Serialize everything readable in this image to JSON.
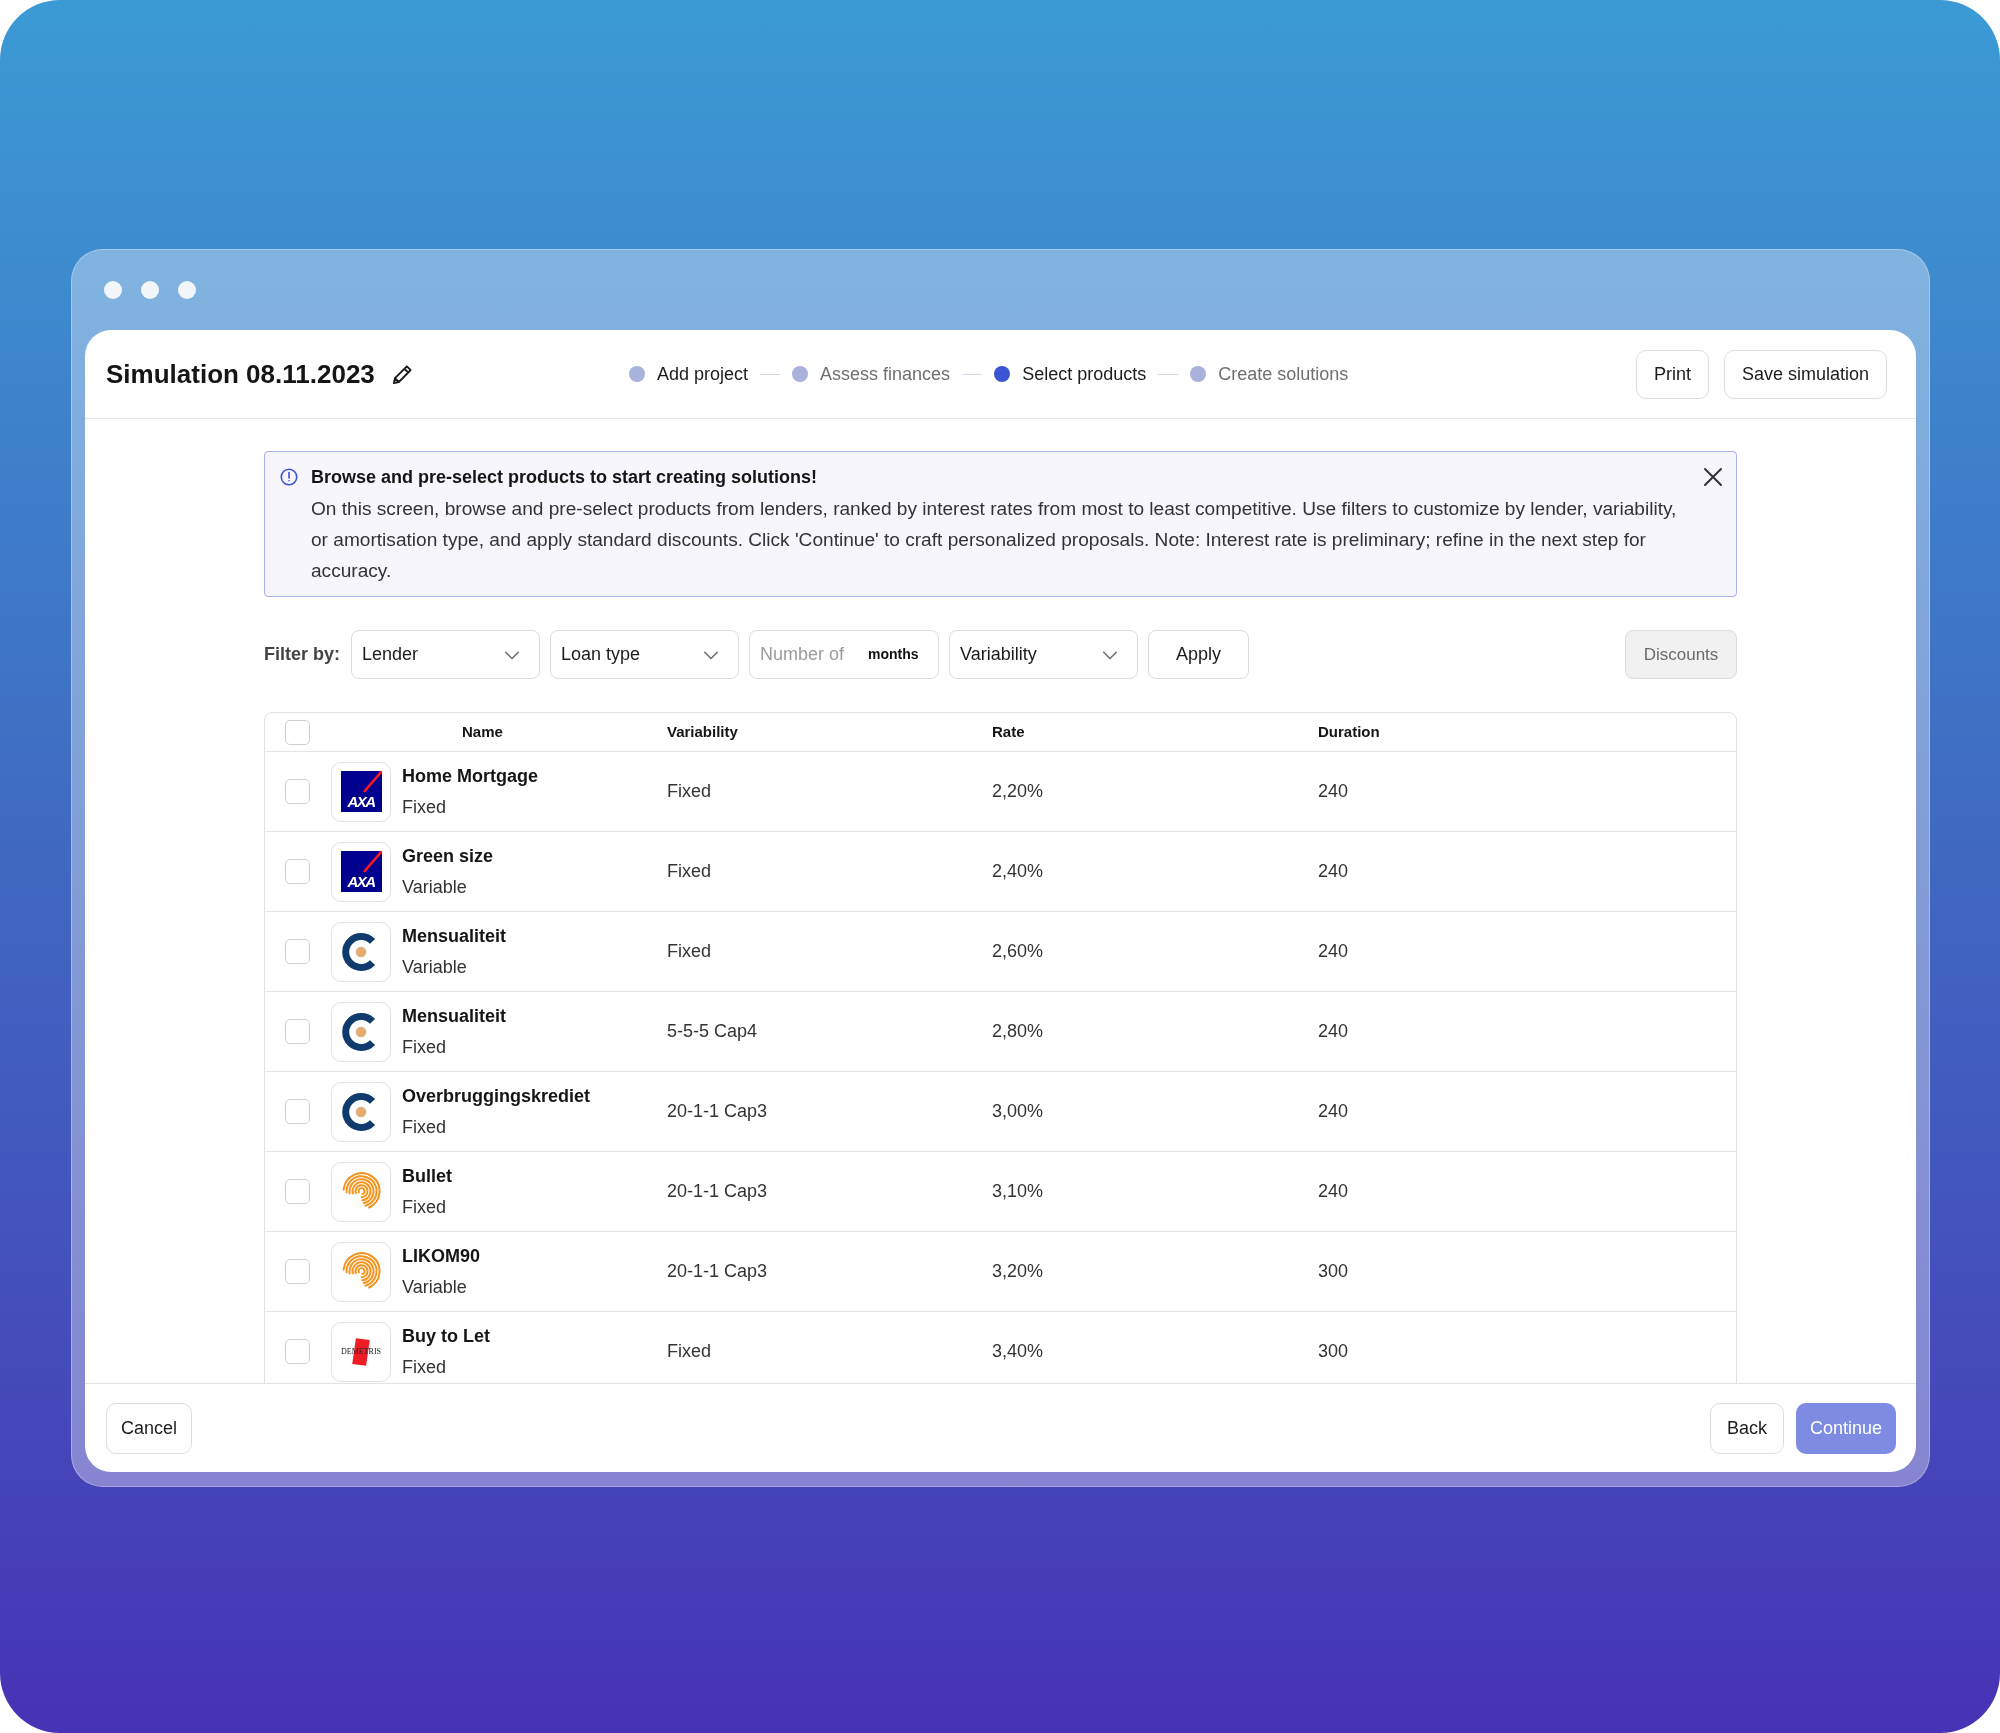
{
  "window": {
    "title": "Simulation 08.11.2023"
  },
  "stepper": [
    {
      "label": "Add project",
      "selected": false,
      "dimmed": false
    },
    {
      "label": "Assess finances",
      "selected": false,
      "dimmed": true
    },
    {
      "label": "Select products",
      "selected": true,
      "dimmed": false
    },
    {
      "label": "Create solutions",
      "selected": false,
      "dimmed": true
    }
  ],
  "header_buttons": [
    {
      "label": "Print"
    },
    {
      "label": "Save simulation"
    }
  ],
  "banner": {
    "title": "Browse and pre-select products to start creating solutions!",
    "text": "On this screen, browse and pre-select products from lenders, ranked by interest rates from most to least competitive. Use filters to customize by lender, variability, or amortisation type, and apply standard discounts. Click 'Continue' to craft personalized proposals. Note: Interest rate is preliminary; refine in the next step for accuracy."
  },
  "filters": {
    "label": "Filter by:",
    "controls": [
      {
        "kind": "select",
        "label": "Lender"
      },
      {
        "kind": "select",
        "label": "Loan type"
      },
      {
        "kind": "input",
        "placeholder": "Number of",
        "suffix": "months"
      },
      {
        "kind": "select",
        "label": "Variability"
      },
      {
        "kind": "button",
        "label": "Apply"
      }
    ],
    "discounts": {
      "label": "Discounts",
      "disabled": true
    }
  },
  "table": {
    "select_all": {
      "checked": false
    },
    "columns": [
      "Name",
      "Variability",
      "Rate",
      "Duration"
    ],
    "rows": [
      {
        "checked": false,
        "logo": {
          "kind": "square_slash",
          "text": "AXA"
        },
        "name": "Home Mortgage",
        "subtitle": "Fixed",
        "variability": "Fixed",
        "rate": "2,20%",
        "duration": "240"
      },
      {
        "checked": false,
        "logo": {
          "kind": "square_slash",
          "text": "AXA"
        },
        "name": "Green size",
        "subtitle": "Variable",
        "variability": "Fixed",
        "rate": "2,40%",
        "duration": "240"
      },
      {
        "checked": false,
        "logo": {
          "kind": "arc_dot"
        },
        "name": "Mensualiteit",
        "subtitle": "Variable",
        "variability": "Fixed",
        "rate": "2,60%",
        "duration": "240"
      },
      {
        "checked": false,
        "logo": {
          "kind": "arc_dot"
        },
        "name": "Mensualiteit",
        "subtitle": "Fixed",
        "variability": "5-5-5 Cap4",
        "rate": "2,80%",
        "duration": "240"
      },
      {
        "checked": false,
        "logo": {
          "kind": "arc_dot"
        },
        "name": "Overbruggingskrediet",
        "subtitle": "Fixed",
        "variability": "20-1-1 Cap3",
        "rate": "3,00%",
        "duration": "240"
      },
      {
        "checked": false,
        "logo": {
          "kind": "fingerprint"
        },
        "name": "Bullet",
        "subtitle": "Fixed",
        "variability": "20-1-1 Cap3",
        "rate": "3,10%",
        "duration": "240"
      },
      {
        "checked": false,
        "logo": {
          "kind": "fingerprint"
        },
        "name": "LIKOM90",
        "subtitle": "Variable",
        "variability": "20-1-1 Cap3",
        "rate": "3,20%",
        "duration": "300"
      },
      {
        "checked": false,
        "logo": {
          "kind": "red_tag",
          "text": "DEMETRIS"
        },
        "name": "Buy to Let",
        "subtitle": "Fixed",
        "variability": "Fixed",
        "rate": "3,40%",
        "duration": "300"
      }
    ]
  },
  "footer": {
    "cancel": {
      "label": "Cancel"
    },
    "back": {
      "label": "Back"
    },
    "continue": {
      "label": "Continue",
      "disabled": true
    }
  }
}
